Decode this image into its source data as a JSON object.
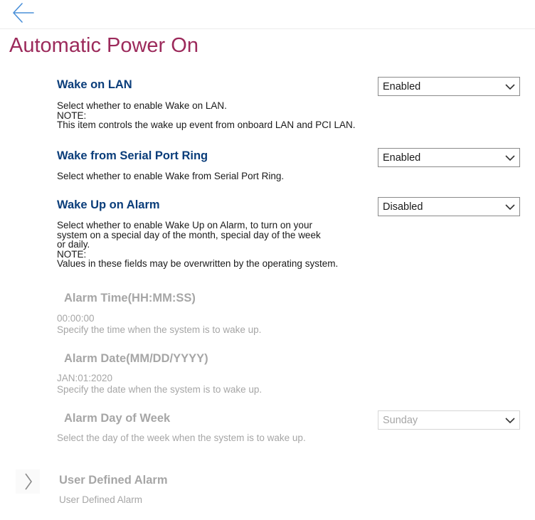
{
  "header": {
    "title": "Automatic Power On"
  },
  "settings": {
    "wake_on_lan": {
      "label": "Wake on LAN",
      "value": "Enabled",
      "help": "Select whether to enable Wake on LAN.\nNOTE:\nThis item controls the wake up event from onboard LAN and PCI LAN."
    },
    "wake_serial": {
      "label": "Wake from Serial Port Ring",
      "value": "Enabled",
      "help": "Select whether to enable Wake from Serial Port Ring."
    },
    "wake_alarm": {
      "label": "Wake Up on Alarm",
      "value": "Disabled",
      "help": "Select whether to enable Wake Up on Alarm, to turn on your\nsystem on a special day of the month, special day of the week\nor daily.\nNOTE:\nValues in these fields may be overwritten by the operating system."
    },
    "alarm_time": {
      "label": "Alarm Time(HH:MM:SS)",
      "value": "00:00:00",
      "help": "Specify the time when the system is to wake up."
    },
    "alarm_date": {
      "label": "Alarm Date(MM/DD/YYYY)",
      "value": "JAN:01:2020",
      "help": "Specify the date when the system is to wake up."
    },
    "alarm_day": {
      "label": "Alarm Day of Week",
      "value": "Sunday",
      "help": "Select the day of the week when the system is to wake up."
    },
    "user_alarm": {
      "label": "User Defined Alarm",
      "help": "User Defined Alarm"
    }
  },
  "colors": {
    "title": "#9c2a5b",
    "label": "#0a3d7a",
    "disabled": "#a6a6a6",
    "back_icon": "#4a90d9"
  },
  "icons": {
    "back": "back-arrow-icon",
    "dropdown": "chevron-down-icon",
    "submenu": "chevron-right-icon"
  }
}
